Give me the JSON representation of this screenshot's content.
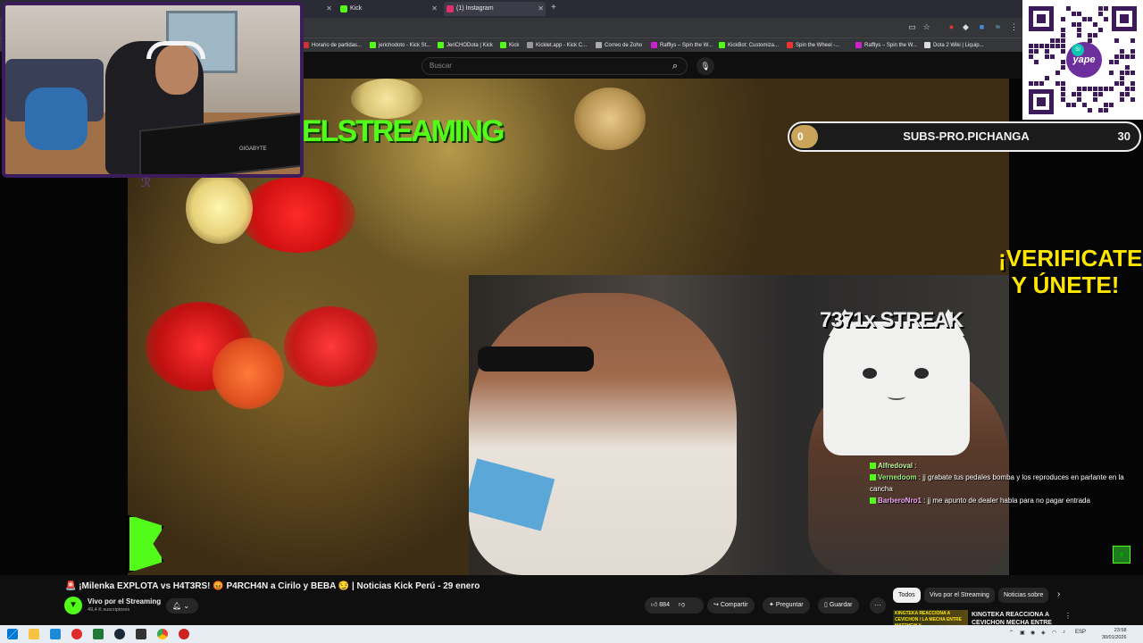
{
  "browser": {
    "tabs": [
      {
        "label": "",
        "icon": "close-icon"
      },
      {
        "label": "Kick",
        "icon": "kick-icon"
      },
      {
        "label": "(1) Instagram",
        "icon": "instagram-icon"
      }
    ],
    "new_tab": "+",
    "bookmarks": [
      "Horario de partidas...",
      "jerichodoto - Kick St...",
      "JeriCHODota | Kick",
      "Kick",
      "Kicklet.app - Kick C...",
      "Correo de Zoho",
      "Rafflys – Spin the W...",
      "KickBot: Customiza...",
      "Spin the Wheel -...",
      "Rafflys – Spin the W...",
      "Dota 2 Wiki | Liquip..."
    ]
  },
  "youtube": {
    "search_placeholder": "Buscar",
    "video_title": "🚨 ¡Milenka EXPLOTA vs H4T3RS! 😡 P4RCH4N a Cirilo y BEBA 😏 | Noticias Kick Perú - 29 enero",
    "channel_name": "Vivo por el Streaming",
    "channel_subs": "49,4 K suscriptores",
    "likes": "884",
    "share_label": "Compartir",
    "ask_label": "Preguntar",
    "save_label": "Guardar",
    "more_label": "···",
    "chips": [
      "Todos",
      "Vivo por el Streaming",
      "Noticias sobre"
    ],
    "rec_thumb_text": "KINGTEKA REACCIONA A CEVICHON / LA MECHA ENTRE MATTHEW Y...",
    "rec_title": "KINGTEKA REACCIONA A CEVICHON MECHA ENTRE"
  },
  "overlay": {
    "elstreaming": "ELSTREAMING",
    "verificate": "¡VERIFICATE Y ÚNETE!",
    "streak": "7371x STREAK",
    "facecam_brand": "GIGABYTE",
    "goal": {
      "title": "SUBS-PRO.PICHANGA",
      "current": "0",
      "target": "30",
      "progress": 0.05
    },
    "qr_brand": "yape",
    "chat": [
      {
        "user": "Alfredoval",
        "text": ""
      },
      {
        "user": "Vernedoom",
        "text": "jj grabate tus pedales bomba y los reproduces en parlante en la cancha"
      },
      {
        "user": "BarberoNro1",
        "text": "jj me apunto de dealer habla para no pagar entrada"
      }
    ]
  },
  "taskbar": {
    "lang": "ESP",
    "time": "23:58",
    "date": "30/01/2026"
  },
  "colors": {
    "kick_green": "#53fc18",
    "yellow": "#ffe600",
    "purple": "#3c1a5b"
  }
}
